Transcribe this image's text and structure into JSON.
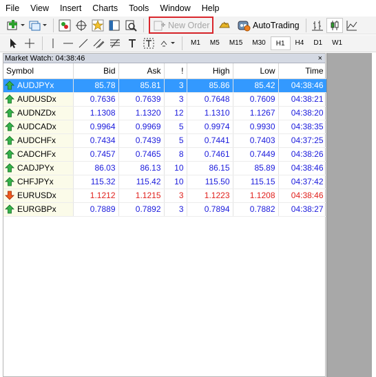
{
  "menu": [
    "File",
    "View",
    "Insert",
    "Charts",
    "Tools",
    "Window",
    "Help"
  ],
  "toolbar": {
    "new_order_label": "New Order",
    "autotrading_label": "AutoTrading"
  },
  "timeframes": [
    "M1",
    "M5",
    "M15",
    "M30",
    "H1",
    "H4",
    "D1",
    "W1"
  ],
  "active_timeframe": "H1",
  "market_watch": {
    "title": "Market Watch: 04:38:46",
    "close_label": "×",
    "columns": [
      "Symbol",
      "Bid",
      "Ask",
      "!",
      "High",
      "Low",
      "Time"
    ],
    "rows": [
      {
        "symbol": "AUDJPYx",
        "bid": "85.78",
        "ask": "85.81",
        "spread": "3",
        "high": "85.86",
        "low": "85.42",
        "time": "04:38:46",
        "dir": "up",
        "selected": true
      },
      {
        "symbol": "AUDUSDx",
        "bid": "0.7636",
        "ask": "0.7639",
        "spread": "3",
        "high": "0.7648",
        "low": "0.7609",
        "time": "04:38:21",
        "dir": "up",
        "selected": false
      },
      {
        "symbol": "AUDNZDx",
        "bid": "1.1308",
        "ask": "1.1320",
        "spread": "12",
        "high": "1.1310",
        "low": "1.1267",
        "time": "04:38:20",
        "dir": "up",
        "selected": false
      },
      {
        "symbol": "AUDCADx",
        "bid": "0.9964",
        "ask": "0.9969",
        "spread": "5",
        "high": "0.9974",
        "low": "0.9930",
        "time": "04:38:35",
        "dir": "up",
        "selected": false
      },
      {
        "symbol": "AUDCHFx",
        "bid": "0.7434",
        "ask": "0.7439",
        "spread": "5",
        "high": "0.7441",
        "low": "0.7403",
        "time": "04:37:25",
        "dir": "up",
        "selected": false
      },
      {
        "symbol": "CADCHFx",
        "bid": "0.7457",
        "ask": "0.7465",
        "spread": "8",
        "high": "0.7461",
        "low": "0.7449",
        "time": "04:38:26",
        "dir": "up",
        "selected": false
      },
      {
        "symbol": "CADJPYx",
        "bid": "86.03",
        "ask": "86.13",
        "spread": "10",
        "high": "86.15",
        "low": "85.89",
        "time": "04:38:46",
        "dir": "up",
        "selected": false
      },
      {
        "symbol": "CHFJPYx",
        "bid": "115.32",
        "ask": "115.42",
        "spread": "10",
        "high": "115.50",
        "low": "115.15",
        "time": "04:37:42",
        "dir": "up",
        "selected": false
      },
      {
        "symbol": "EURUSDx",
        "bid": "1.1212",
        "ask": "1.1215",
        "spread": "3",
        "high": "1.1223",
        "low": "1.1208",
        "time": "04:38:46",
        "dir": "down",
        "selected": false
      },
      {
        "symbol": "EURGBPx",
        "bid": "0.7889",
        "ask": "0.7892",
        "spread": "3",
        "high": "0.7894",
        "low": "0.7882",
        "time": "04:38:27",
        "dir": "up",
        "selected": false
      }
    ]
  },
  "colors": {
    "up": "#1a1adc",
    "down": "#e0201c",
    "selected": "#3399ff",
    "new_order_highlight": "#d9252b"
  }
}
